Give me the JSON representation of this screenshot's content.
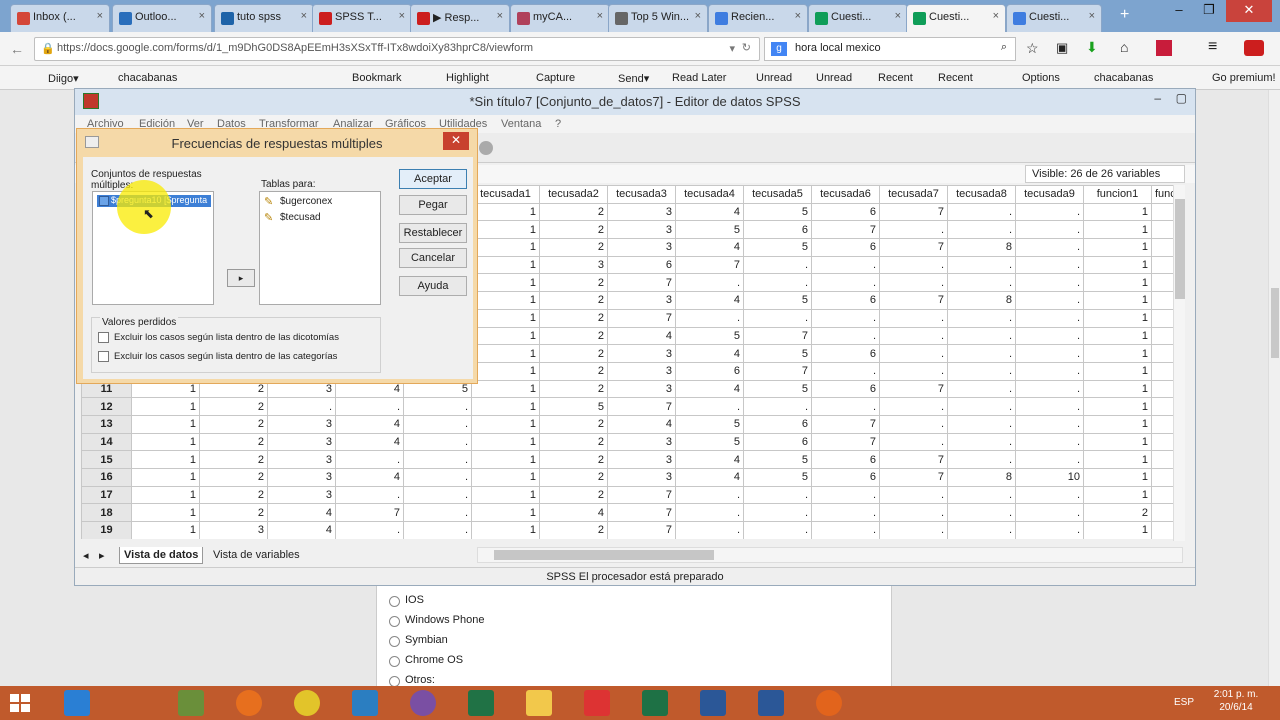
{
  "browser": {
    "tabs": [
      {
        "label": "Inbox (...",
        "color": "#d44638"
      },
      {
        "label": "Outloo...",
        "color": "#2a6ebb"
      },
      {
        "label": "tuto spss",
        "color": "#1e63a8"
      },
      {
        "label": "SPSS T...",
        "color": "#cc1e1e"
      },
      {
        "label": "▶ Resp...",
        "color": "#cc1e1e"
      },
      {
        "label": "myCA...",
        "color": "#b0415b"
      },
      {
        "label": "Top 5 Win...",
        "color": "#666666"
      },
      {
        "label": "Recien...",
        "color": "#3f7de0"
      },
      {
        "label": "Cuesti...",
        "color": "#0f9d58"
      },
      {
        "label": "Cuesti...",
        "color": "#0f9d58"
      },
      {
        "label": "Cuesti...",
        "color": "#3f7de0"
      }
    ],
    "url": "https://docs.google.com/forms/d/1_m9DhG0DS8ApEEmH3sXSxTff-ITx8wdoiXy83hprC8/viewform",
    "search_value": "hora local mexico",
    "bookmarks": [
      "Diigo▾",
      "chacabanas",
      "Bookmark",
      "Highlight",
      "Capture",
      "Send▾",
      "Read Later",
      "Unread",
      "Unread",
      "Recent",
      "Recent",
      "Options",
      "chacabanas",
      "Go premium!"
    ]
  },
  "spss": {
    "title": "*Sin título7 [Conjunto_de_datos7] - Editor de datos SPSS",
    "menu": [
      "Archivo",
      "Edición",
      "Ver",
      "Datos",
      "Transformar",
      "Analizar",
      "Gráficos",
      "Utilidades",
      "Ventana",
      "?"
    ],
    "visible": "Visible: 26 de 26 variables",
    "columns": [
      "tecusada1",
      "tecusada2",
      "tecusada3",
      "tecusada4",
      "tecusada5",
      "tecusada6",
      "tecusada7",
      "tecusada8",
      "tecusada9",
      "funcion1",
      "func"
    ],
    "rows": [
      {
        "n": "",
        "left": [
          "",
          "",
          "",
          "",
          ""
        ],
        "vals": [
          "1",
          "2",
          "3",
          "4",
          "5",
          "6",
          "7",
          ".",
          ".",
          "1",
          ""
        ]
      },
      {
        "n": "",
        "left": [
          "",
          "",
          "",
          "",
          ""
        ],
        "vals": [
          "1",
          "2",
          "3",
          "5",
          "6",
          "7",
          ".",
          ".",
          ".",
          "1",
          ""
        ]
      },
      {
        "n": "",
        "left": [
          "",
          "",
          "",
          "",
          ""
        ],
        "vals": [
          "1",
          "2",
          "3",
          "4",
          "5",
          "6",
          "7",
          "8",
          ".",
          "1",
          ""
        ]
      },
      {
        "n": "",
        "left": [
          "",
          "",
          "",
          "",
          ""
        ],
        "vals": [
          "1",
          "3",
          "6",
          "7",
          ".",
          ".",
          ".",
          ".",
          ".",
          "1",
          ""
        ]
      },
      {
        "n": "",
        "left": [
          "",
          "",
          "",
          "",
          ""
        ],
        "vals": [
          "1",
          "2",
          "7",
          ".",
          ".",
          ".",
          ".",
          ".",
          ".",
          "1",
          ""
        ]
      },
      {
        "n": "",
        "left": [
          "",
          "",
          "",
          "",
          ""
        ],
        "vals": [
          "1",
          "2",
          "3",
          "4",
          "5",
          "6",
          "7",
          "8",
          ".",
          "1",
          ""
        ]
      },
      {
        "n": "",
        "left": [
          "",
          "",
          "",
          "",
          ""
        ],
        "vals": [
          "1",
          "2",
          "7",
          ".",
          ".",
          ".",
          ".",
          ".",
          ".",
          "1",
          ""
        ]
      },
      {
        "n": "",
        "left": [
          "",
          "",
          "",
          "",
          ""
        ],
        "vals": [
          "1",
          "2",
          "4",
          "5",
          "7",
          ".",
          ".",
          ".",
          ".",
          "1",
          ""
        ]
      },
      {
        "n": "",
        "left": [
          "",
          "",
          "",
          "",
          ""
        ],
        "vals": [
          "1",
          "2",
          "3",
          "4",
          "5",
          "6",
          ".",
          ".",
          ".",
          "1",
          ""
        ]
      },
      {
        "n": "",
        "left": [
          "",
          "",
          "",
          "",
          ""
        ],
        "vals": [
          "1",
          "2",
          "3",
          "6",
          "7",
          ".",
          ".",
          ".",
          ".",
          "1",
          ""
        ]
      },
      {
        "n": "11",
        "left": [
          "1",
          "2",
          "3",
          "4",
          "5"
        ],
        "vals": [
          "1",
          "2",
          "3",
          "4",
          "5",
          "6",
          "7",
          ".",
          ".",
          "1",
          ""
        ]
      },
      {
        "n": "12",
        "left": [
          "1",
          "2",
          ".",
          ".",
          "."
        ],
        "vals": [
          "1",
          "5",
          "7",
          ".",
          ".",
          ".",
          ".",
          ".",
          ".",
          "1",
          ""
        ]
      },
      {
        "n": "13",
        "left": [
          "1",
          "2",
          "3",
          "4",
          "."
        ],
        "vals": [
          "1",
          "2",
          "4",
          "5",
          "6",
          "7",
          ".",
          ".",
          ".",
          "1",
          ""
        ]
      },
      {
        "n": "14",
        "left": [
          "1",
          "2",
          "3",
          "4",
          "."
        ],
        "vals": [
          "1",
          "2",
          "3",
          "5",
          "6",
          "7",
          ".",
          ".",
          ".",
          "1",
          ""
        ]
      },
      {
        "n": "15",
        "left": [
          "1",
          "2",
          "3",
          ".",
          "."
        ],
        "vals": [
          "1",
          "2",
          "3",
          "4",
          "5",
          "6",
          "7",
          ".",
          ".",
          "1",
          ""
        ]
      },
      {
        "n": "16",
        "left": [
          "1",
          "2",
          "3",
          "4",
          "."
        ],
        "vals": [
          "1",
          "2",
          "3",
          "4",
          "5",
          "6",
          "7",
          "8",
          "10",
          "1",
          ""
        ]
      },
      {
        "n": "17",
        "left": [
          "1",
          "2",
          "3",
          ".",
          "."
        ],
        "vals": [
          "1",
          "2",
          "7",
          ".",
          ".",
          ".",
          ".",
          ".",
          ".",
          "1",
          ""
        ]
      },
      {
        "n": "18",
        "left": [
          "1",
          "2",
          "4",
          "7",
          "."
        ],
        "vals": [
          "1",
          "4",
          "7",
          ".",
          ".",
          ".",
          ".",
          ".",
          ".",
          "2",
          ""
        ]
      },
      {
        "n": "19",
        "left": [
          "1",
          "3",
          "4",
          ".",
          "."
        ],
        "vals": [
          "1",
          "2",
          "7",
          ".",
          ".",
          ".",
          ".",
          ".",
          ".",
          "1",
          ""
        ]
      }
    ],
    "tab_data": "Vista de datos",
    "tab_vars": "Vista de variables",
    "status": "SPSS El procesador  está preparado"
  },
  "dialog": {
    "title": "Frecuencias de respuestas múltiples",
    "sets_label": "Conjuntos de respuestas múltiples:",
    "sets_item": "$pregunta10 [$pregunta",
    "tables_label": "Tablas para:",
    "tables_items": [
      "$ugerconex",
      "$tecusad"
    ],
    "buttons": [
      "Aceptar",
      "Pegar",
      "Restablecer",
      "Cancelar",
      "Ayuda"
    ],
    "missing_label": "Valores perdidos",
    "chk1": "Excluir los casos según lista dentro de las dicotomías",
    "chk2": "Excluir los casos según lista dentro de las categorías"
  },
  "form": {
    "options": [
      "IOS",
      "Windows Phone",
      "Symbian",
      "Chrome OS",
      "Otros:"
    ]
  },
  "taskbar": {
    "lang": "ESP",
    "time": "2:01 p. m.",
    "date": "20/6/14"
  }
}
